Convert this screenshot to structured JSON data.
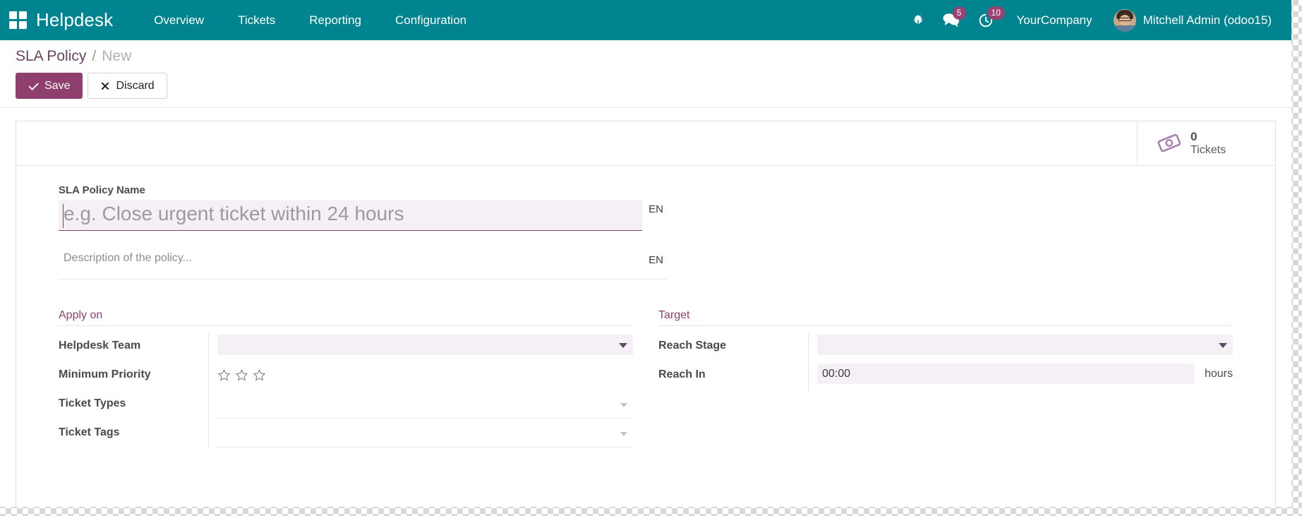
{
  "theme": {
    "navbar_bg": "#00848f",
    "primary_purple": "#8f3f6e",
    "badge_bg": "#9a4372",
    "field_highlight": "#f5eff6"
  },
  "navbar": {
    "apps_icon": "apps-grid-icon",
    "brand": "Helpdesk",
    "menu": [
      {
        "label": "Overview"
      },
      {
        "label": "Tickets"
      },
      {
        "label": "Reporting"
      },
      {
        "label": "Configuration"
      }
    ],
    "debug_icon": "bug-icon",
    "messages_icon": "messages-icon",
    "messages_count": "5",
    "activities_icon": "clock-icon",
    "activities_count": "10",
    "company": "YourCompany",
    "avatar_icon": "user-avatar",
    "user": "Mitchell Admin (odoo15)"
  },
  "control_panel": {
    "breadcrumb_root": "SLA Policy",
    "breadcrumb_separator": "/",
    "breadcrumb_current": "New",
    "save_label": "Save",
    "save_icon": "check-icon",
    "discard_label": "Discard",
    "discard_icon": "times-icon"
  },
  "stat_buttons": [
    {
      "icon": "ticket-icon",
      "value": "0",
      "label": "Tickets"
    }
  ],
  "form": {
    "name_field": {
      "label": "SLA Policy Name",
      "value": "",
      "placeholder": "e.g. Close urgent ticket within 24 hours",
      "lang": "EN"
    },
    "description_field": {
      "value": "",
      "placeholder": "Description of the policy...",
      "lang": "EN"
    },
    "apply_on": {
      "title": "Apply on",
      "fields": [
        {
          "label": "Helpdesk Team",
          "type": "select-required",
          "value": ""
        },
        {
          "label": "Minimum Priority",
          "type": "stars",
          "value": "0",
          "max": "3"
        },
        {
          "label": "Ticket Types",
          "type": "select",
          "value": ""
        },
        {
          "label": "Ticket Tags",
          "type": "select",
          "value": ""
        }
      ]
    },
    "target": {
      "title": "Target",
      "fields": [
        {
          "label": "Reach Stage",
          "type": "select-required",
          "value": ""
        },
        {
          "label": "Reach In",
          "type": "text",
          "value": "00:00",
          "suffix": "hours"
        }
      ]
    }
  }
}
